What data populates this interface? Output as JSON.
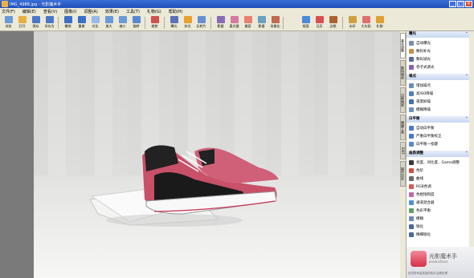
{
  "window": {
    "title": "IMG_4988.jpg - 光影魔术手",
    "controls": [
      "_",
      "□",
      "×"
    ]
  },
  "menu": [
    "文件(F)",
    "编辑(E)",
    "查看(V)",
    "图像(I)",
    "调整(A)",
    "效果(E)",
    "工具(T)",
    "礼物(G)",
    "帮助(H)"
  ],
  "toolbar": [
    {
      "label": "浏览",
      "color": "#6a9ad8"
    },
    {
      "label": "打开",
      "color": "#e8b040"
    },
    {
      "label": "保存",
      "color": "#4a78c8"
    },
    {
      "label": "另存为",
      "color": "#4a78c8"
    },
    {
      "label": "撤销",
      "color": "#3a70c8"
    },
    {
      "label": "重做",
      "color": "#3a70c8"
    },
    {
      "label": "对比",
      "color": "#9ab8e8"
    },
    {
      "label": "放大",
      "color": "#6a9ad8"
    },
    {
      "label": "缩小",
      "color": "#6a9ad8"
    },
    {
      "label": "旋转",
      "color": "#5a88d0"
    },
    {
      "label": "裁剪",
      "color": "#d05050"
    },
    {
      "label": "曝光",
      "color": "#5a70b8"
    },
    {
      "label": "补光",
      "color": "#e8a030"
    },
    {
      "label": "反转片",
      "color": "#6890d0"
    },
    {
      "label": "影楼",
      "color": "#8a6ab8"
    },
    {
      "label": "柔光镜",
      "color": "#d87aa0"
    },
    {
      "label": "美容",
      "color": "#e88070"
    },
    {
      "label": "影楼",
      "color": "#6aa0c0"
    },
    {
      "label": "风格化",
      "color": "#c06a50"
    },
    {
      "label": "抠图",
      "color": "#4a8ad8"
    },
    {
      "label": "日历",
      "color": "#d85050"
    },
    {
      "label": "边框",
      "color": "#b06030"
    },
    {
      "label": "水印",
      "color": "#d0a040"
    },
    {
      "label": "大头贴",
      "color": "#e07070"
    },
    {
      "label": "礼物",
      "color": "#e0a030"
    }
  ],
  "vertical_tabs": [
    "基本调整",
    "数码暗房",
    "边框图层",
    "便捷工具",
    "EXIF",
    "操作历史"
  ],
  "panel": {
    "sections": [
      {
        "title": "曝光",
        "items": [
          {
            "label": "自动曝光",
            "color": "#7a8ab8"
          },
          {
            "label": "数码补光",
            "color": "#c89050"
          },
          {
            "label": "数码减光",
            "color": "#5a6a9a"
          },
          {
            "label": "卷子式调光",
            "color": "#8a60b0"
          }
        ]
      },
      {
        "title": "噪点",
        "items": [
          {
            "label": "增加噪点",
            "color": "#6a8ac0"
          },
          {
            "label": "高ISO降噪",
            "color": "#5080c0"
          },
          {
            "label": "夜景抑噪",
            "color": "#4070b0"
          },
          {
            "label": "模糊降噪",
            "color": "#6a90c8"
          }
        ]
      },
      {
        "title": "白平衡",
        "items": [
          {
            "label": "自动白平衡",
            "color": "#4a7ac8"
          },
          {
            "label": "严重白平衡校正",
            "color": "#4a7ac8"
          },
          {
            "label": "白平衡一指键",
            "color": "#5a8ad0"
          }
        ]
      },
      {
        "title": "画质调整",
        "items": [
          {
            "label": "亮度、对比度、Gama调整",
            "color": "#3a3a3a"
          },
          {
            "label": "色阶",
            "color": "#d05040"
          },
          {
            "label": "曲线",
            "color": "#6a6a6a"
          },
          {
            "label": "RGB色调",
            "color": "#d85a5a"
          },
          {
            "label": "色相饱和度",
            "color": "#c06ab0"
          },
          {
            "label": "通道混合器",
            "color": "#5090d0"
          },
          {
            "label": "色彩平衡",
            "color": "#60a060"
          },
          {
            "label": "模糊",
            "color": "#6a8ab8"
          },
          {
            "label": "锐化",
            "color": "#4a6a9a"
          },
          {
            "label": "精细锐化",
            "color": "#4a6a9a"
          }
        ]
      }
    ]
  },
  "promo": {
    "title": "光影魔术手",
    "subtitle": "productions",
    "footer": "给您带来高质量的相片后期处理"
  }
}
